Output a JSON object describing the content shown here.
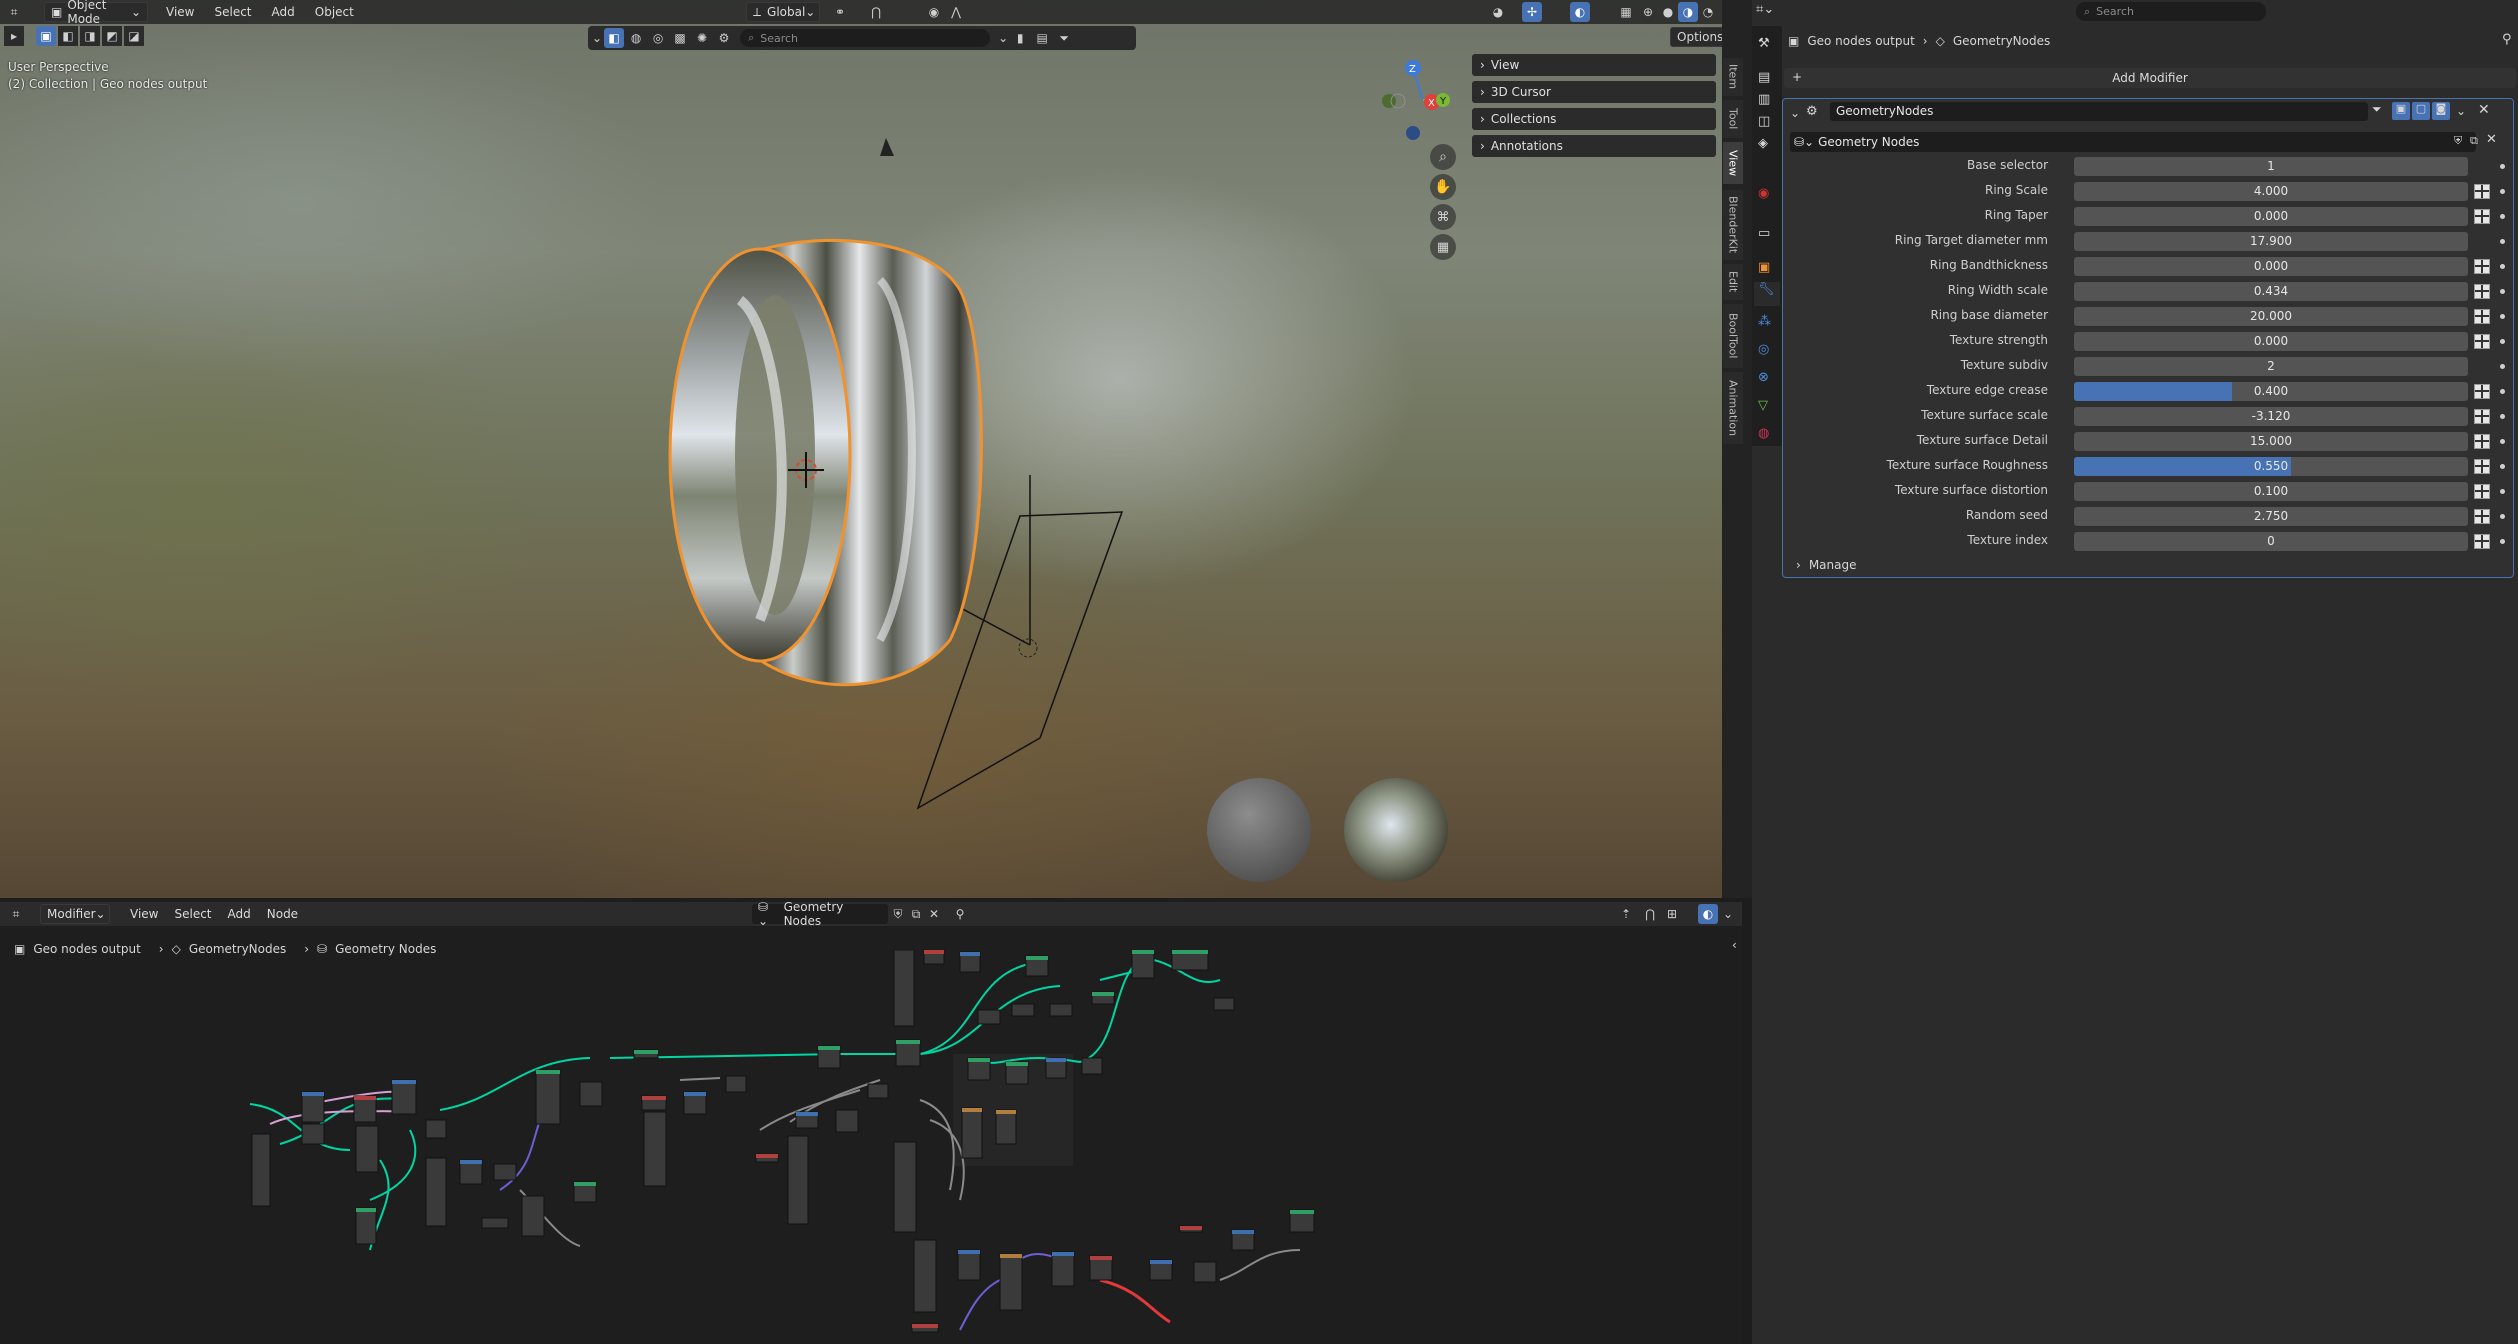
{
  "viewport": {
    "mode": "Object Mode",
    "menus": [
      "View",
      "Select",
      "Add",
      "Object"
    ],
    "orientation": "Global",
    "options": "Options",
    "search_placeholder": "Search",
    "overlay_title": "User Perspective",
    "overlay_info": "(2) Collection | Geo nodes output",
    "side_panel": [
      "View",
      "3D Cursor",
      "Collections",
      "Annotations"
    ],
    "side_tabs": [
      "Item",
      "Tool",
      "View",
      "BlenderKit",
      "Edit",
      "BoolTool",
      "Animation"
    ],
    "gizmo": {
      "z": "Z",
      "x": "X",
      "y": "Y"
    }
  },
  "properties": {
    "search_placeholder": "Search",
    "breadcrumb": [
      "Geo nodes output",
      "GeometryNodes"
    ],
    "add_modifier": "Add Modifier",
    "modifier_name": "GeometryNodes",
    "node_group": "Geometry Nodes",
    "manage": "Manage",
    "params": [
      {
        "label": "Base selector",
        "value": "1",
        "fill": 0,
        "key": false
      },
      {
        "label": "Ring Scale",
        "value": "4.000",
        "fill": 0,
        "key": true
      },
      {
        "label": "Ring Taper",
        "value": "0.000",
        "fill": 0,
        "key": true
      },
      {
        "label": "Ring Target diameter mm",
        "value": "17.900",
        "fill": 0,
        "key": false
      },
      {
        "label": "Ring Bandthickness",
        "value": "0.000",
        "fill": 0,
        "key": true
      },
      {
        "label": "Ring Width scale",
        "value": "0.434",
        "fill": 0,
        "key": true
      },
      {
        "label": "Ring base diameter",
        "value": "20.000",
        "fill": 0,
        "key": true
      },
      {
        "label": "Texture strength",
        "value": "0.000",
        "fill": 0,
        "key": true
      },
      {
        "label": "Texture subdiv",
        "value": "2",
        "fill": 0,
        "key": false
      },
      {
        "label": "Texture edge crease",
        "value": "0.400",
        "fill": 0.4,
        "key": true
      },
      {
        "label": "Texture surface scale",
        "value": "-3.120",
        "fill": 0,
        "key": true
      },
      {
        "label": "Texture surface Detail",
        "value": "15.000",
        "fill": 0,
        "key": true
      },
      {
        "label": "Texture surface Roughness",
        "value": "0.550",
        "fill": 0.55,
        "key": true
      },
      {
        "label": "Texture surface distortion",
        "value": "0.100",
        "fill": 0,
        "key": true
      },
      {
        "label": "Random seed",
        "value": "2.750",
        "fill": 0,
        "key": true
      },
      {
        "label": "Texture index",
        "value": "0",
        "fill": 0,
        "key": true
      }
    ]
  },
  "node_editor": {
    "type": "Modifier",
    "menus": [
      "View",
      "Select",
      "Add",
      "Node"
    ],
    "tree_name": "Geometry Nodes",
    "breadcrumb": [
      "Geo nodes output",
      "GeometryNodes",
      "Geometry Nodes"
    ]
  },
  "colors": {
    "accent": "#4772b3",
    "selection": "#f0922e",
    "link_geometry": "#00d6a3"
  }
}
